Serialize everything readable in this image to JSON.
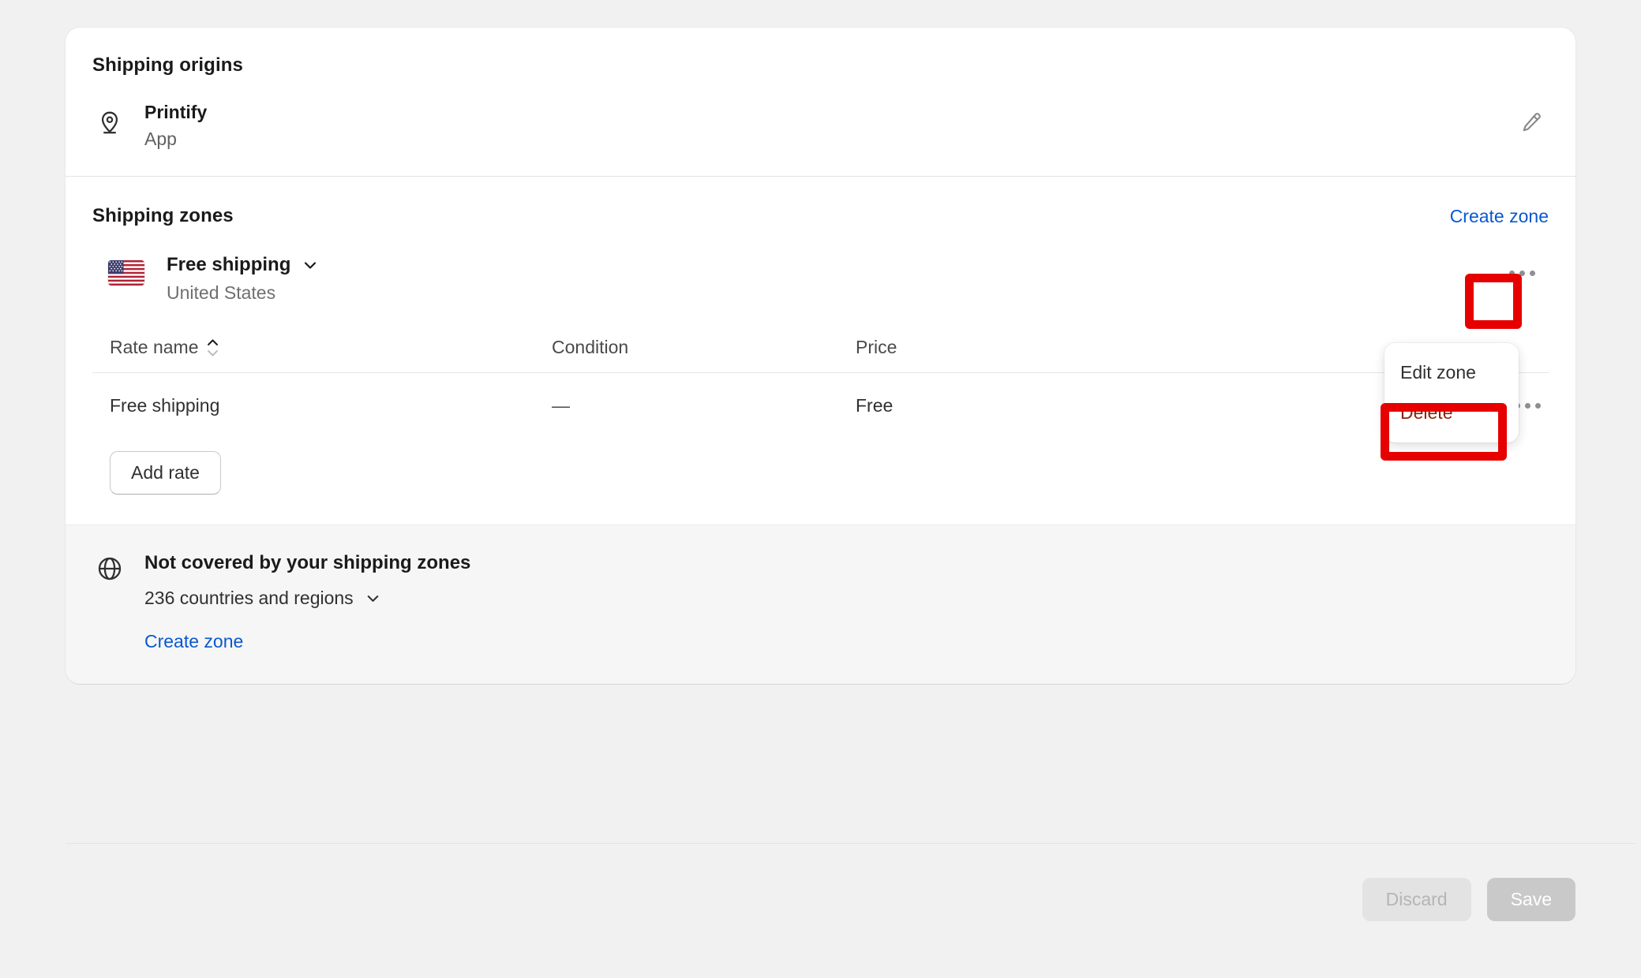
{
  "card": {
    "origins": {
      "title": "Shipping origins",
      "icon": "location-pin-icon",
      "items": [
        {
          "name": "Printify",
          "sub": "App",
          "edit_icon": "pencil-icon"
        }
      ]
    },
    "zones": {
      "title": "Shipping zones",
      "create_link": "Create zone",
      "zone": {
        "flag": "us-flag-icon",
        "name": "Free shipping",
        "chevron": "chevron-down-icon",
        "countries": "United States",
        "kebab": "more-horizontal-icon"
      },
      "table": {
        "headers": {
          "rate_name": "Rate name",
          "sort_icon": "sort-ascending-descending-icon",
          "condition": "Condition",
          "price": "Price"
        },
        "rows": [
          {
            "rate_name": "Free shipping",
            "condition": "—",
            "price": "Free",
            "kebab": "more-horizontal-icon"
          }
        ]
      },
      "add_rate_label": "Add rate"
    },
    "not_covered": {
      "icon": "globe-icon",
      "title": "Not covered by your shipping zones",
      "count": "236 countries and regions",
      "chevron": "chevron-down-icon",
      "create_link": "Create zone"
    }
  },
  "popover": {
    "items": [
      {
        "label": "Edit zone",
        "variant": "default"
      },
      {
        "label": "Delete",
        "variant": "danger"
      }
    ]
  },
  "footer": {
    "discard_label": "Discard",
    "save_label": "Save"
  },
  "colors": {
    "accent_link": "#0a58d0",
    "danger_text": "#8e1f0b",
    "annotation": "#e60000",
    "page_bg": "#f1f1f1",
    "card_bg": "#ffffff",
    "footer_bg": "#f6f6f6"
  }
}
